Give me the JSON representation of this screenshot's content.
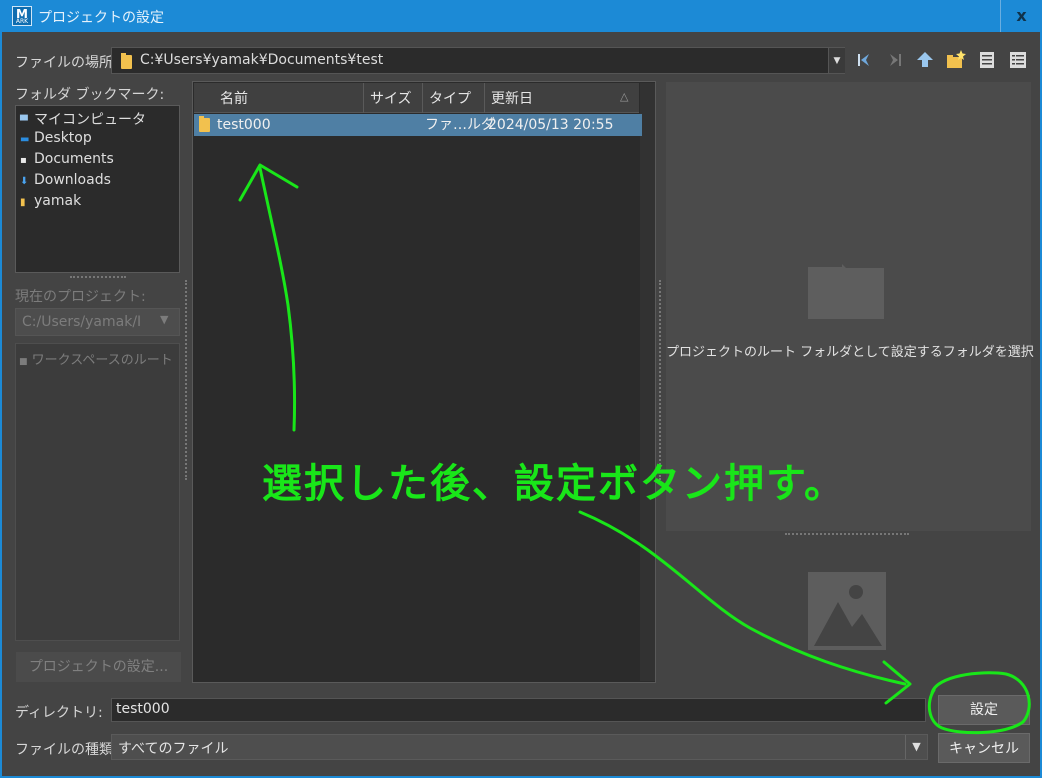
{
  "window": {
    "title": "プロジェクトの設定",
    "logo": "M",
    "logo_sub": "ARK",
    "close_label": "x"
  },
  "location": {
    "label": "ファイルの場所:",
    "path": "C:¥Users¥yamak¥Documents¥test"
  },
  "toolbar": {
    "icons": [
      "back-icon",
      "forward-icon",
      "up-folder-icon",
      "new-folder-icon",
      "list-view-icon",
      "detail-view-icon"
    ]
  },
  "bookmarks": {
    "label": "フォルダ ブックマーク:",
    "items": [
      {
        "label": "マイコンピュータ",
        "icon": "computer-icon"
      },
      {
        "label": "Desktop",
        "icon": "desktop-icon"
      },
      {
        "label": "Documents",
        "icon": "document-icon"
      },
      {
        "label": "Downloads",
        "icon": "download-arrow-icon"
      },
      {
        "label": "yamak",
        "icon": "user-folder-icon"
      }
    ]
  },
  "current_project": {
    "label": "現在のプロジェクト:",
    "value": "C:/Users/yamak/I"
  },
  "workspace": {
    "root_label": "ワークスペースのルート"
  },
  "set_project_button": "プロジェクトの設定...",
  "file_list": {
    "columns": [
      "名前",
      "サイズ",
      "タイプ",
      "更新日"
    ],
    "rows": [
      {
        "name": "test000",
        "size": "",
        "type": "ファ…ルダ",
        "modified": "2024/05/13 20:55",
        "selected": true
      }
    ]
  },
  "preview": {
    "message": "プロジェクトのルート フォルダとして設定するフォルダを選択"
  },
  "directory": {
    "label": "ディレクトリ:",
    "value": "test000"
  },
  "file_type": {
    "label": "ファイルの種類:",
    "value": "すべてのファイル"
  },
  "buttons": {
    "set": "設定",
    "cancel": "キャンセル"
  },
  "annotation": {
    "text": "選択した後、設定ボタン押す。",
    "color": "#19e619"
  },
  "colors": {
    "titlebar": "#1c8ad6",
    "selection": "#4f7fa4",
    "background": "#444444"
  }
}
